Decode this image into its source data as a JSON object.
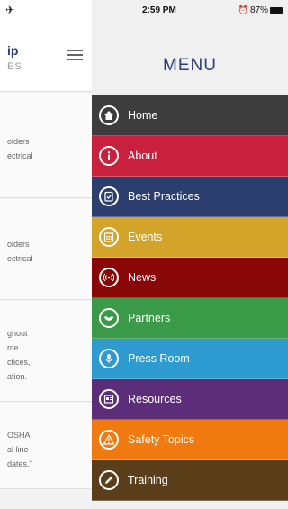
{
  "background": {
    "title_line1": "ip",
    "title_line2": "ES",
    "cards": [
      {
        "lines": [
          "olders",
          "ectrical"
        ]
      },
      {
        "lines": [
          "olders",
          "ectrical"
        ]
      },
      {
        "lines": [
          "ghout",
          "rce",
          "ctices,",
          "ation."
        ]
      },
      {
        "lines": [
          "OSHA",
          "al line",
          "dates.\""
        ]
      }
    ]
  },
  "status": {
    "time": "2:59 PM",
    "battery": "87%"
  },
  "menu": {
    "title": "MENU",
    "items": [
      {
        "label": "Home",
        "color": "#3d3d3d",
        "icon": "home-icon"
      },
      {
        "label": "About",
        "color": "#c8203d",
        "icon": "info-icon"
      },
      {
        "label": "Best Practices",
        "color": "#2c3e6e",
        "icon": "clipboard-icon"
      },
      {
        "label": "Events",
        "color": "#d4a32a",
        "icon": "calendar-icon"
      },
      {
        "label": "News",
        "color": "#8a0707",
        "icon": "broadcast-icon"
      },
      {
        "label": "Partners",
        "color": "#3a9a47",
        "icon": "handshake-icon"
      },
      {
        "label": "Press Room",
        "color": "#2d9ad0",
        "icon": "microphone-icon"
      },
      {
        "label": "Resources",
        "color": "#5c2e7a",
        "icon": "document-icon"
      },
      {
        "label": "Safety Topics",
        "color": "#f07a10",
        "icon": "warning-icon"
      },
      {
        "label": "Training",
        "color": "#5a3f1a",
        "icon": "pencil-icon"
      }
    ]
  }
}
